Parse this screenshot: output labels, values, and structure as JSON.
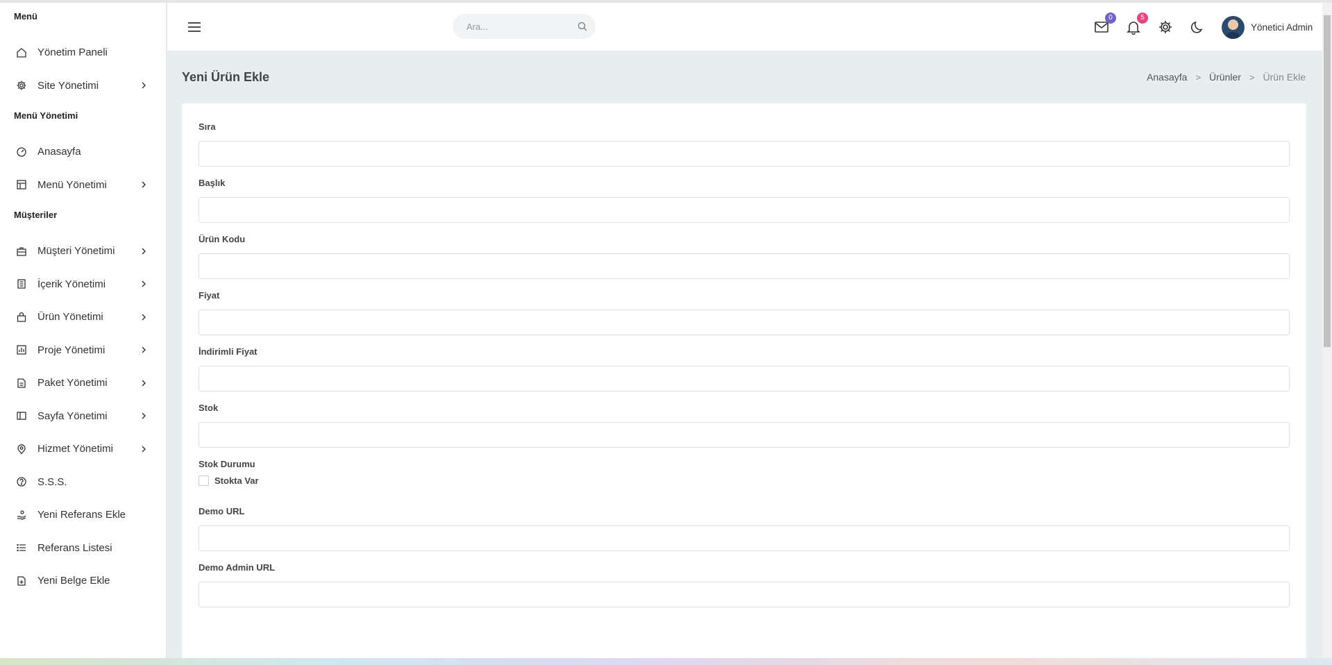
{
  "sidebar": {
    "sections": [
      {
        "header": "Menü",
        "items": [
          {
            "label": "Yönetim Paneli",
            "icon": "home-icon",
            "chevron": false
          },
          {
            "label": "Site Yönetimi",
            "icon": "gear-icon",
            "chevron": true
          }
        ]
      },
      {
        "header": "Menü Yönetimi",
        "items": [
          {
            "label": "Anasayfa",
            "icon": "gauge-icon",
            "chevron": false
          },
          {
            "label": "Menü Yönetimi",
            "icon": "layout-icon",
            "chevron": true
          }
        ]
      },
      {
        "header": "Müşteriler",
        "items": [
          {
            "label": "Müşteri Yönetimi",
            "icon": "briefcase-icon",
            "chevron": true
          },
          {
            "label": "İçerik Yönetimi",
            "icon": "document-list-icon",
            "chevron": true
          },
          {
            "label": "Ürün Yönetimi",
            "icon": "shopping-bag-icon",
            "chevron": true
          },
          {
            "label": "Proje Yönetimi",
            "icon": "bar-chart-icon",
            "chevron": true
          },
          {
            "label": "Paket Yönetimi",
            "icon": "file-icon",
            "chevron": true
          },
          {
            "label": "Sayfa Yönetimi",
            "icon": "sidebar-layout-icon",
            "chevron": true
          },
          {
            "label": "Hizmet Yönetimi",
            "icon": "map-pin-icon",
            "chevron": true
          },
          {
            "label": "S.S.S.",
            "icon": "help-circle-icon",
            "chevron": false
          },
          {
            "label": "Yeni Referans Ekle",
            "icon": "hand-coins-icon",
            "chevron": false
          },
          {
            "label": "Referans Listesi",
            "icon": "list-icon",
            "chevron": false
          },
          {
            "label": "Yeni Belge Ekle",
            "icon": "file-plus-icon",
            "chevron": false
          }
        ]
      }
    ]
  },
  "topbar": {
    "search_placeholder": "Ara...",
    "mail_count": "0",
    "notification_count": "5",
    "user_name": "Yönetici Admin",
    "colors": {
      "mail_badge": "#6f63c9",
      "notification_badge": "#e8457c"
    }
  },
  "page": {
    "title": "Yeni Ürün Ekle",
    "breadcrumb": [
      "Anasayfa",
      "Ürünler",
      "Ürün Ekle"
    ]
  },
  "form": {
    "fields": [
      {
        "label": "Sıra",
        "value": ""
      },
      {
        "label": "Başlık",
        "value": ""
      },
      {
        "label": "Ürün Kodu",
        "value": ""
      },
      {
        "label": "Fiyat",
        "value": ""
      },
      {
        "label": "İndirimli Fiyat",
        "value": ""
      },
      {
        "label": "Stok",
        "value": ""
      }
    ],
    "stock_status": {
      "label": "Stok Durumu",
      "checkbox_label": "Stokta Var",
      "checked": false
    },
    "fields_after": [
      {
        "label": "Demo URL",
        "value": ""
      },
      {
        "label": "Demo Admin URL",
        "value": ""
      }
    ]
  }
}
